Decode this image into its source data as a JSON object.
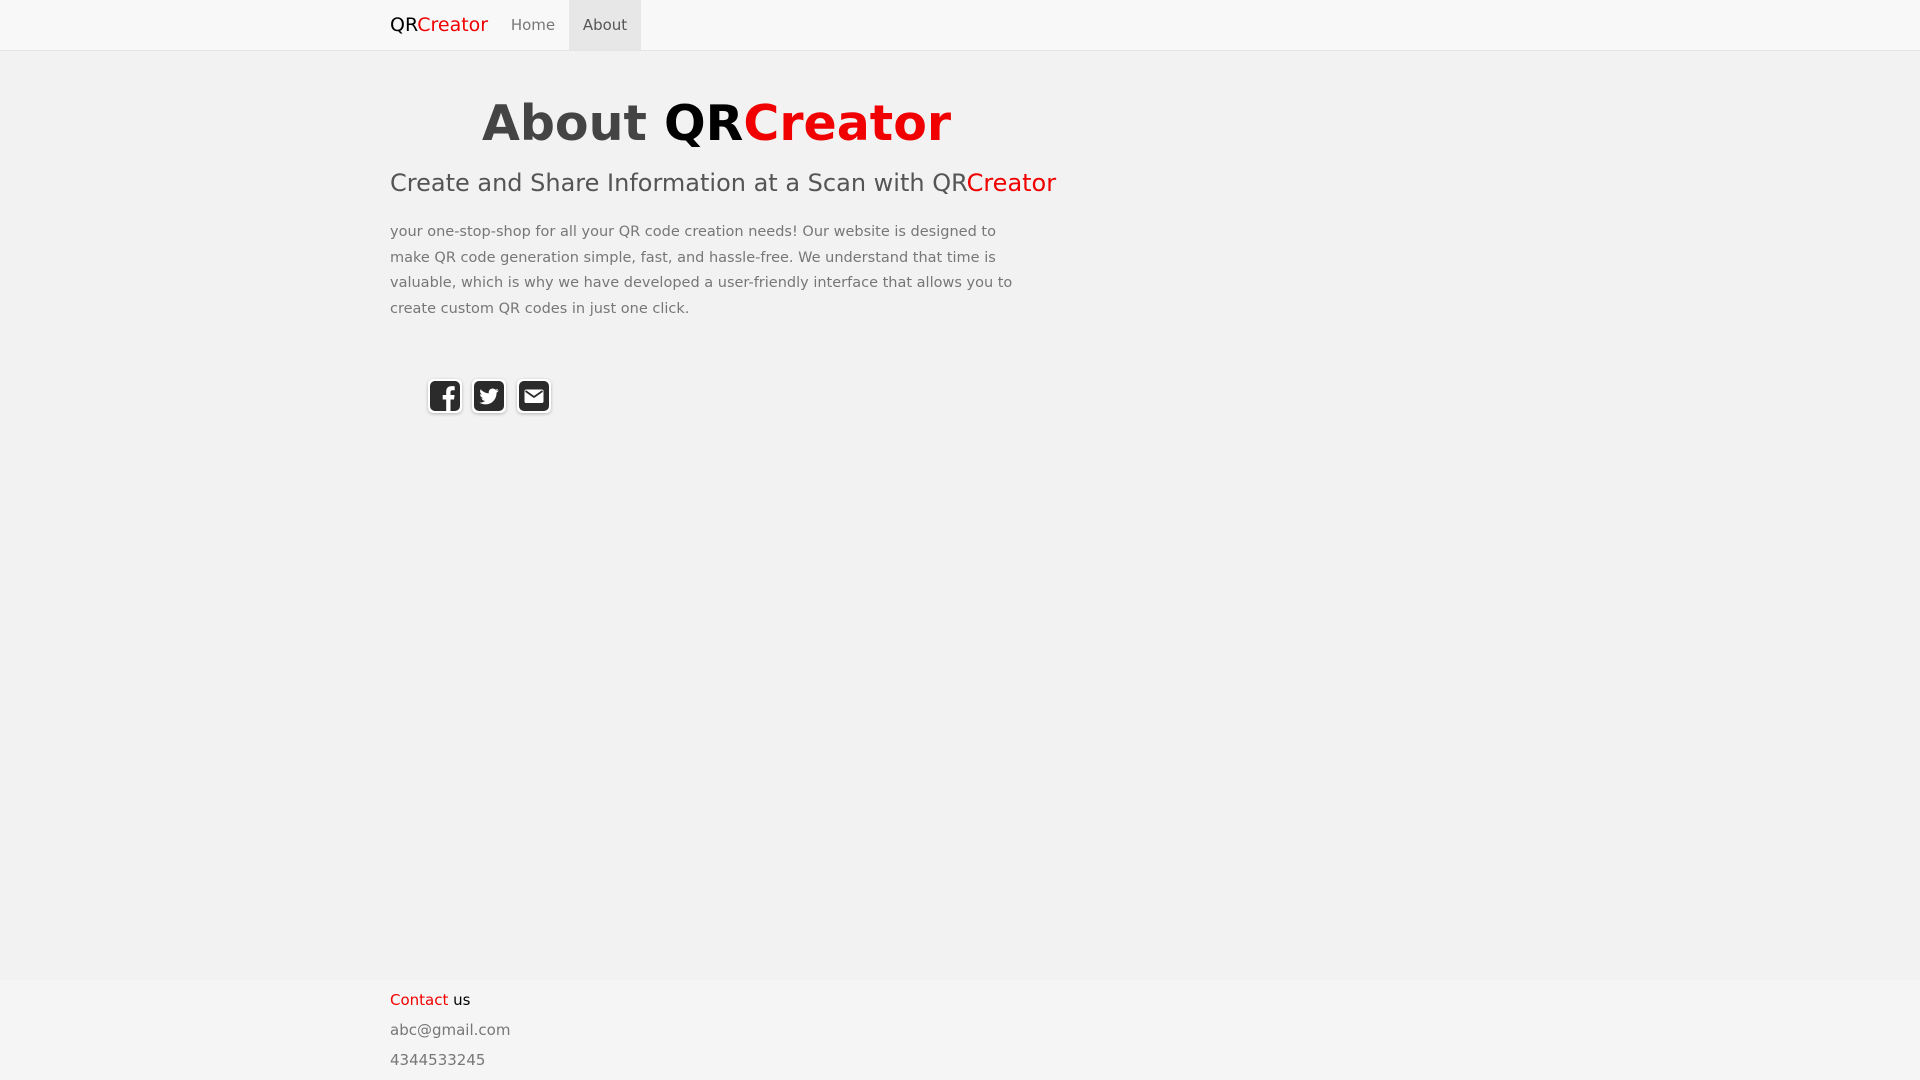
{
  "navbar": {
    "brand_prefix": "QR",
    "brand_accent": "Creator",
    "links": [
      {
        "label": "Home",
        "active": false
      },
      {
        "label": "About",
        "active": true
      }
    ]
  },
  "main": {
    "title_prefix": "About",
    "title_brand_prefix": "QR",
    "title_brand_accent": "Creator",
    "subtitle_text": "Create and Share Information at a Scan with QR",
    "subtitle_accent": "Creator",
    "description": "your one-stop-shop for all your QR code creation needs! Our website is designed to make QR code generation simple, fast, and hassle-free. We understand that time is valuable, which is why we have developed a user-friendly interface that allows you to create custom QR codes in just one click.",
    "social_icons": [
      "facebook-icon",
      "twitter-icon",
      "email-icon"
    ]
  },
  "footer": {
    "contact_accent": "Contact",
    "contact_rest": " us",
    "email": "abc@gmail.com",
    "phone": "4344533245"
  },
  "colors": {
    "accent": "#f00000",
    "icon": "#2b2b2b",
    "background": "#f2f2f2"
  }
}
